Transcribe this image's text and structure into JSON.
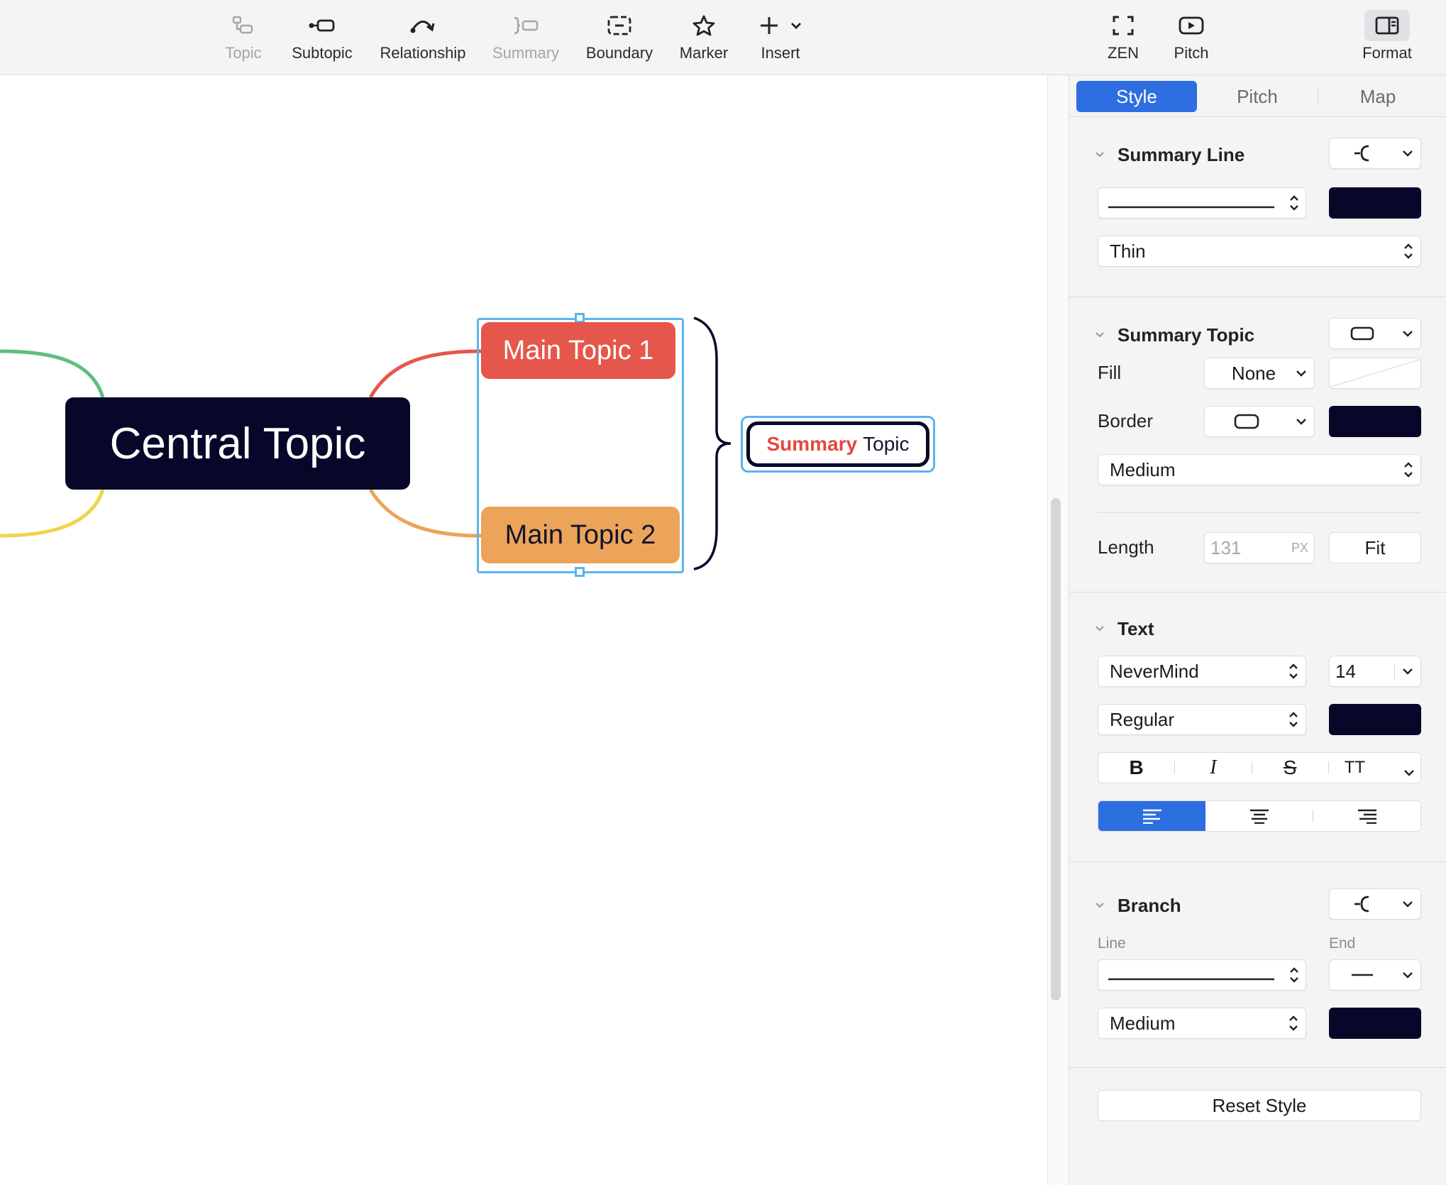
{
  "toolbar": {
    "topic": "Topic",
    "subtopic": "Subtopic",
    "relationship": "Relationship",
    "summary": "Summary",
    "boundary": "Boundary",
    "marker": "Marker",
    "insert": "Insert",
    "zen": "ZEN",
    "pitch": "Pitch",
    "format": "Format"
  },
  "canvas": {
    "central_topic": "Central Topic",
    "main_topic_1": "Main Topic 1",
    "main_topic_2": "Main Topic 2",
    "summary_word1": "Summary",
    "summary_word2": "Topic"
  },
  "panel": {
    "tabs": [
      "Style",
      "Pitch",
      "Map"
    ],
    "summary_line": {
      "title": "Summary Line",
      "width": "Thin"
    },
    "summary_topic": {
      "title": "Summary Topic",
      "fill_label": "Fill",
      "fill_value": "None",
      "border_label": "Border",
      "border_width": "Medium",
      "length_label": "Length",
      "length_value": "131",
      "length_unit": "PX",
      "fit_label": "Fit"
    },
    "text": {
      "title": "Text",
      "font": "NeverMind",
      "size": "14",
      "weight": "Regular",
      "bold": "B",
      "italic": "I",
      "strike": "S",
      "case": "TT"
    },
    "branch": {
      "title": "Branch",
      "line_label": "Line",
      "end_label": "End",
      "width": "Medium"
    },
    "reset_label": "Reset Style"
  },
  "colors": {
    "accent": "#2d6ee0",
    "selection": "#5cb3ee",
    "dark_navy": "#07072a",
    "topic1": "#e5574a",
    "topic2": "#eba45a",
    "branch_green": "#5cbf7e",
    "branch_yellow": "#f0d44c"
  }
}
